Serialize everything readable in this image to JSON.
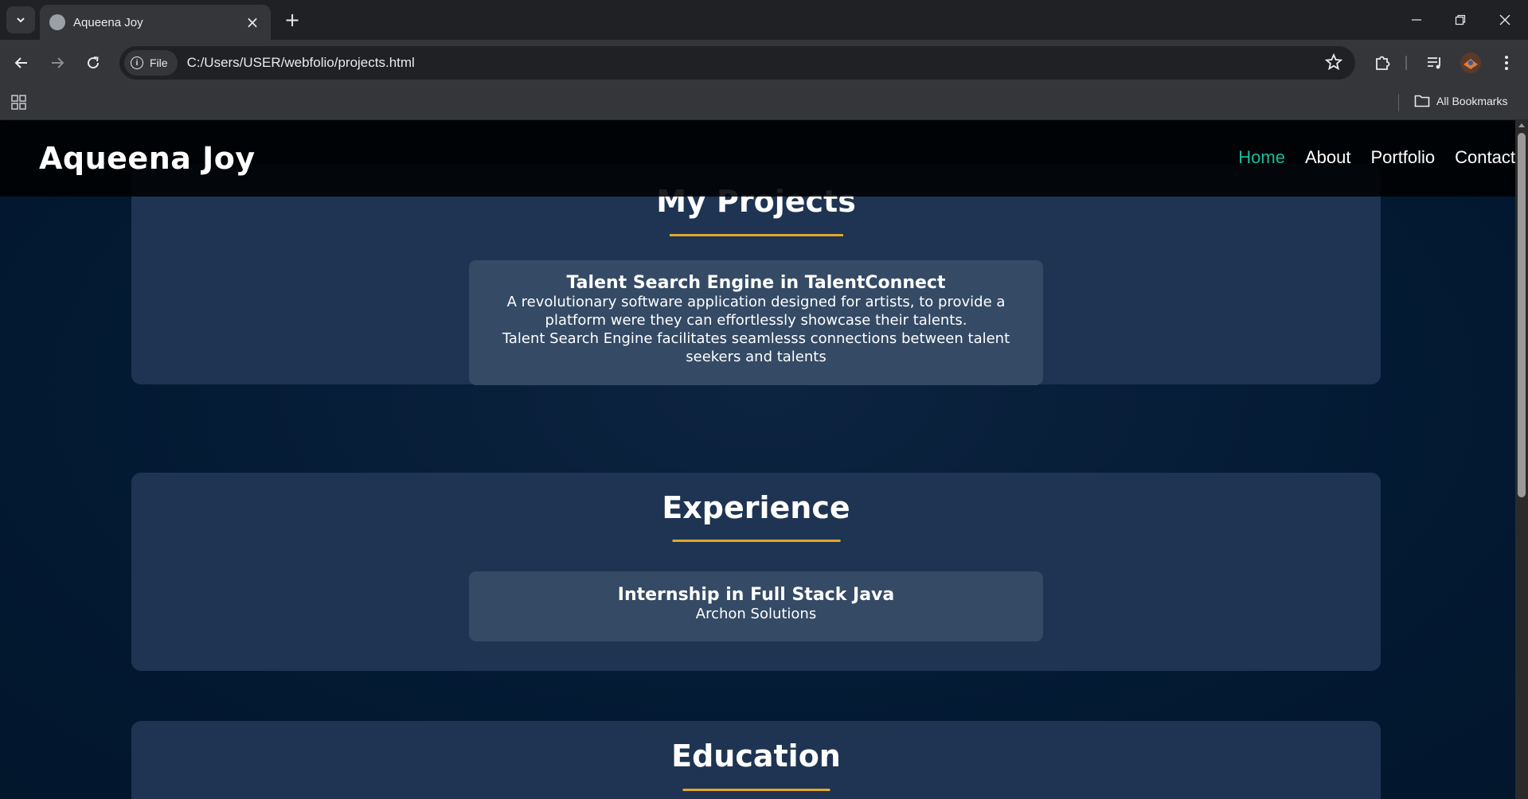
{
  "browser": {
    "tab_title": "Aqueena Joy",
    "site_chip": "File",
    "url": "C:/Users/USER/webfolio/projects.html",
    "all_bookmarks": "All Bookmarks"
  },
  "site": {
    "brand": "Aqueena Joy",
    "menu": [
      {
        "label": "Home",
        "active": true
      },
      {
        "label": "About"
      },
      {
        "label": "Portfolio"
      },
      {
        "label": "Contact"
      }
    ],
    "accent_color": "#1abc9c",
    "underline_color": "#e0a82e"
  },
  "projects": {
    "heading": "My Projects",
    "card": {
      "title": "Talent Search Engine in TalentConnect",
      "line1": "A revolutionary software application designed for artists, to provide a",
      "line2": "platform were they can effortlessly showcase their talents.",
      "line3": "Talent Search Engine facilitates seamlesss connections between talent",
      "line4": "seekers and talents"
    }
  },
  "experience": {
    "heading": "Experience",
    "card": {
      "title": "Internship in Full Stack Java",
      "subtitle": "Archon Solutions"
    }
  },
  "education": {
    "heading": "Education"
  }
}
